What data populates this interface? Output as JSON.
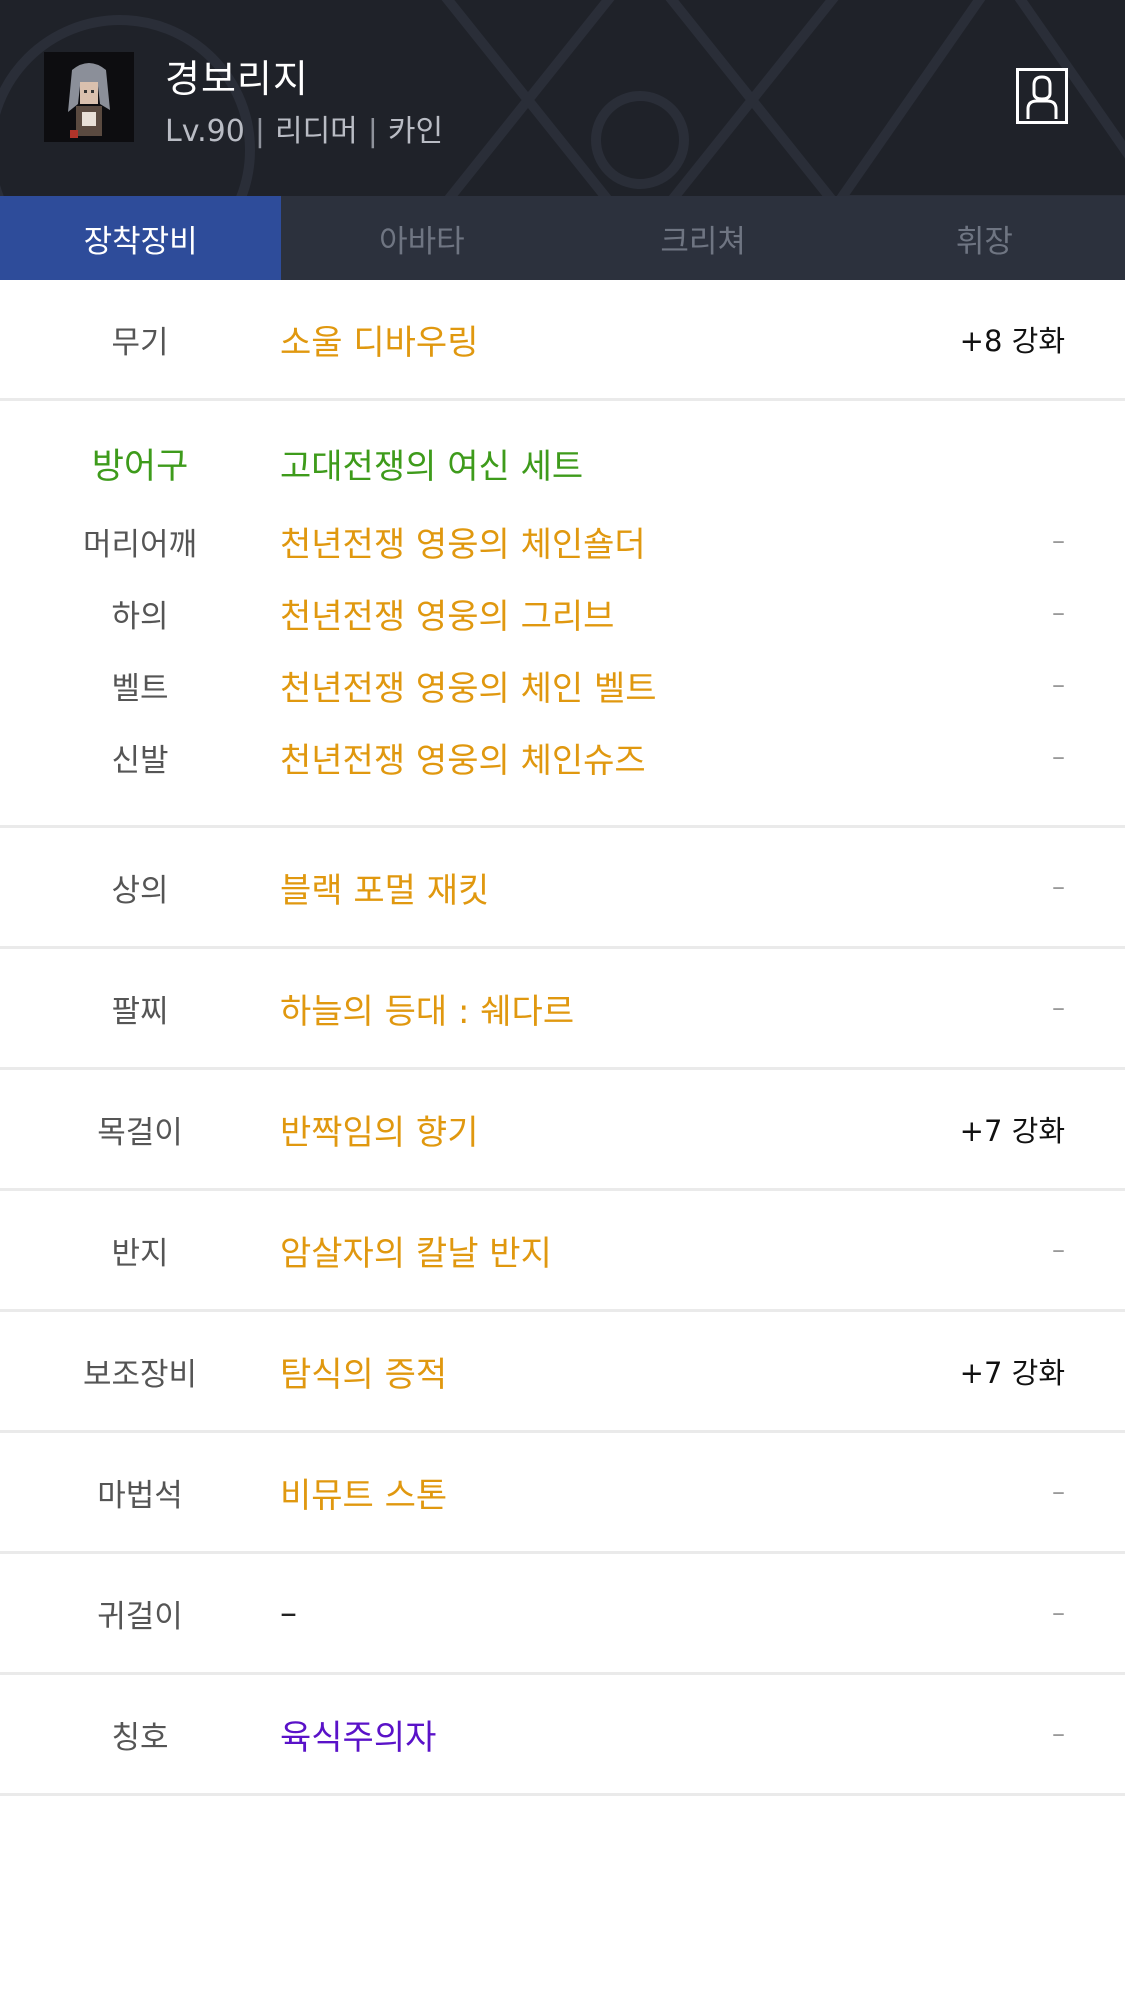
{
  "header": {
    "name": "경보리지",
    "level": "Lv.90",
    "job": "리디머",
    "server": "카인",
    "sep": "|"
  },
  "tabs": [
    {
      "label": "장착장비",
      "active": true
    },
    {
      "label": "아바타",
      "active": false
    },
    {
      "label": "크리쳐",
      "active": false
    },
    {
      "label": "휘장",
      "active": false
    }
  ],
  "weapon": {
    "slot": "무기",
    "item": "소울 디바우링",
    "enhance": "+8 강화"
  },
  "armor": {
    "group_label": "방어구",
    "set_name": "고대전쟁의 여신 세트",
    "items": [
      {
        "slot": "머리어깨",
        "item": "천년전쟁 영웅의 체인숄더",
        "enhance": "–"
      },
      {
        "slot": "하의",
        "item": "천년전쟁 영웅의 그리브",
        "enhance": "–"
      },
      {
        "slot": "벨트",
        "item": "천년전쟁 영웅의 체인 벨트",
        "enhance": "–"
      },
      {
        "slot": "신발",
        "item": "천년전쟁 영웅의 체인슈즈",
        "enhance": "–"
      }
    ]
  },
  "rows": [
    {
      "slot": "상의",
      "item": "블랙 포멀 재킷",
      "enhance": "–"
    },
    {
      "slot": "팔찌",
      "item": "하늘의 등대 : 쉐다르",
      "enhance": "–"
    },
    {
      "slot": "목걸이",
      "item": "반짝임의 향기",
      "enhance": "+7 강화"
    },
    {
      "slot": "반지",
      "item": "암살자의 칼날 반지",
      "enhance": "–"
    },
    {
      "slot": "보조장비",
      "item": "탐식의 증적",
      "enhance": "+7 강화"
    },
    {
      "slot": "마법석",
      "item": "비뮤트 스톤",
      "enhance": "–"
    },
    {
      "slot": "귀걸이",
      "item": "–",
      "enhance": "–"
    },
    {
      "slot": "칭호",
      "item": "육식주의자",
      "enhance": "–"
    }
  ],
  "colors": {
    "header_bg": "#1f2229",
    "tab_active": "#2e4c9a",
    "tab_bar": "#2c313d",
    "item_unique": "#e0980f",
    "set_green": "#3e9b1b",
    "title_purple": "#5a12c8"
  },
  "icons": {
    "profile": "person-icon"
  }
}
